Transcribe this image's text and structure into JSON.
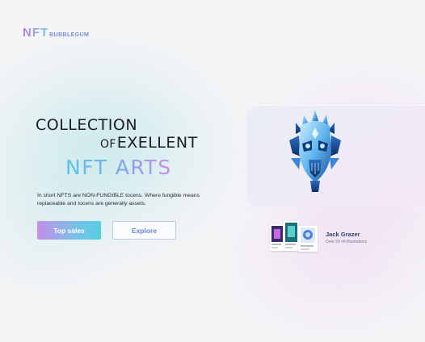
{
  "brand": {
    "logo_main": "NFT",
    "logo_sub": "BUBBLEGUM"
  },
  "hero": {
    "line1": "COLLECTION",
    "line2_of": "OF",
    "line2_rest": "EXELLENT",
    "line3": "NFT ARTS",
    "description": "In short NFTS are NON-FUNGIBLE tocens. Where fungible means replaceable and tocens are generally assets."
  },
  "buttons": {
    "top_sales": "Top sales",
    "explore": "Explore"
  },
  "artist": {
    "name": "Jack Grazer",
    "subtitle": "Over 50 nft illustrations"
  },
  "colors": {
    "accent_purple": "#c48ee8",
    "accent_cyan": "#56cfe0",
    "text_dark": "#1d1d22"
  },
  "icons": {
    "hero_art": "robot-head-illustration",
    "thumbnails": "nft-artwork-thumbnails"
  }
}
